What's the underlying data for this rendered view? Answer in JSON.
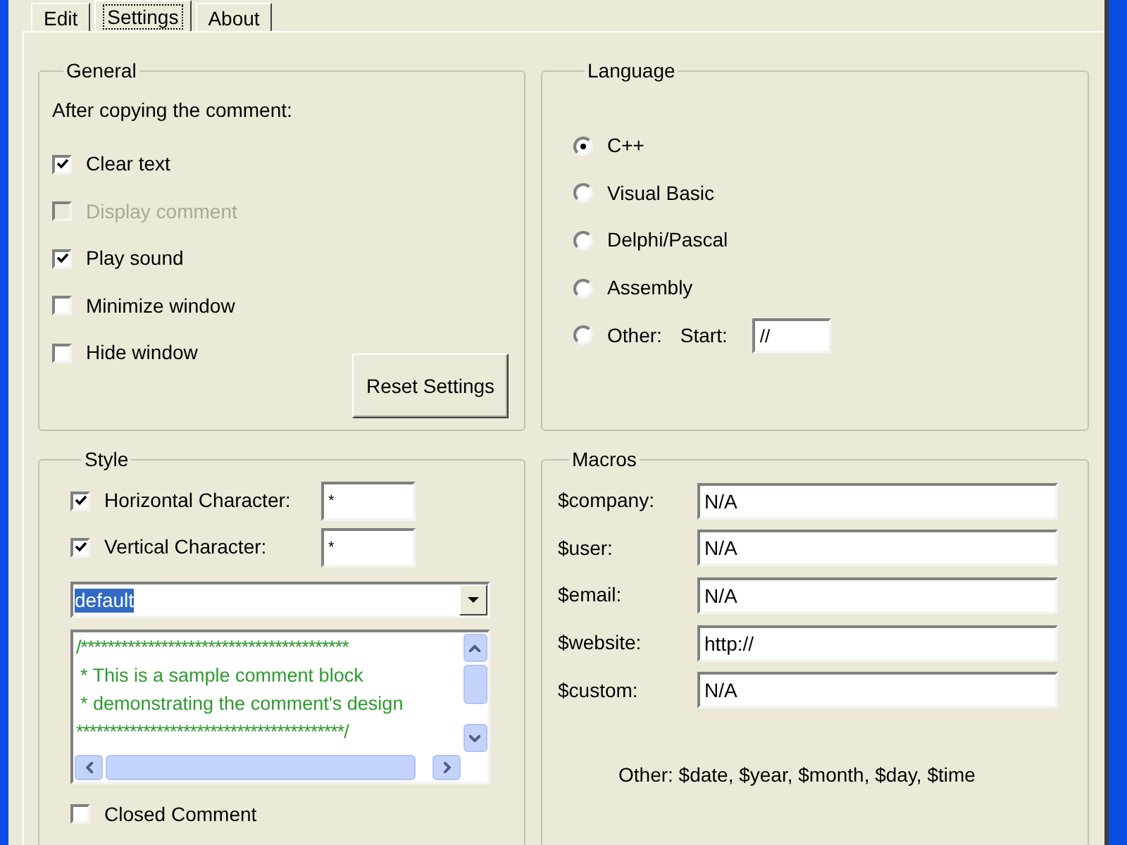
{
  "tabs": [
    {
      "label": "Edit",
      "selected": false
    },
    {
      "label": "Settings",
      "selected": true
    },
    {
      "label": "About",
      "selected": false
    }
  ],
  "general": {
    "title": "General",
    "intro": "After copying the comment:",
    "options": [
      {
        "label": "Clear text",
        "checked": true,
        "disabled": false
      },
      {
        "label": "Display comment",
        "checked": false,
        "disabled": true
      },
      {
        "label": "Play sound",
        "checked": true,
        "disabled": false
      },
      {
        "label": "Minimize window",
        "checked": false,
        "disabled": false
      },
      {
        "label": "Hide window",
        "checked": false,
        "disabled": false
      }
    ],
    "reset_button": "Reset Settings"
  },
  "language": {
    "title": "Language",
    "options": [
      {
        "label": "C++",
        "selected": true
      },
      {
        "label": "Visual Basic",
        "selected": false
      },
      {
        "label": "Delphi/Pascal",
        "selected": false
      },
      {
        "label": "Assembly",
        "selected": false
      },
      {
        "label": "Other:",
        "selected": false
      }
    ],
    "start_field": {
      "label": "Start:",
      "value": "//"
    }
  },
  "style": {
    "title": "Style",
    "characters": [
      {
        "label": "Horizontal Character:",
        "checked": true,
        "value": "*"
      },
      {
        "label": "Vertical Character:",
        "checked": true,
        "value": "*"
      }
    ],
    "preset": "default",
    "preview": [
      "/****************************************",
      "* This is a sample comment block",
      "* demonstrating the comment's design",
      "****************************************/"
    ],
    "closed_comment": {
      "label": "Closed Comment",
      "checked": false
    }
  },
  "macros": {
    "title": "Macros",
    "fields": [
      {
        "label": "$company:",
        "value": "N/A"
      },
      {
        "label": "$user:",
        "value": "N/A"
      },
      {
        "label": "$email:",
        "value": "N/A"
      },
      {
        "label": "$website:",
        "value": "http://"
      },
      {
        "label": "$custom:",
        "value": "N/A"
      }
    ],
    "note": "Other: $date, $year, $month, $day, $time"
  }
}
